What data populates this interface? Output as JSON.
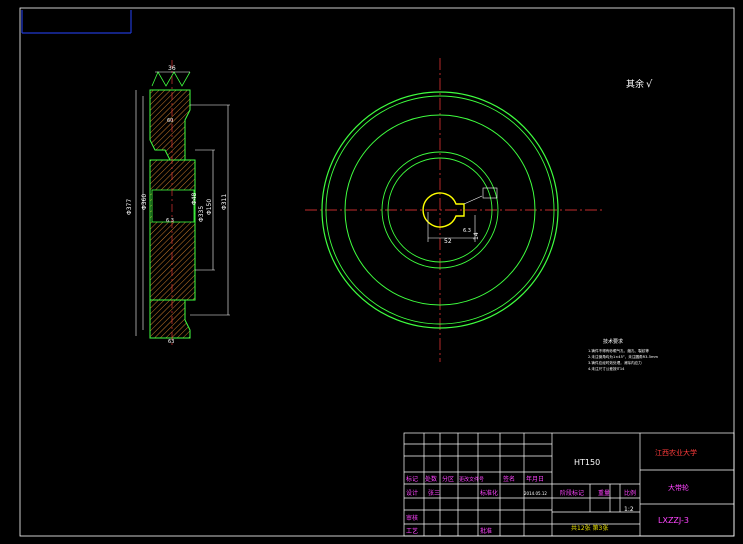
{
  "colors": {
    "background": "#000000",
    "outline": "#3fff3f",
    "hatch": "#c87a2a",
    "centerline": "#ff3b3b",
    "frame": "#2038d0",
    "dimension": "#ffffff",
    "title_red": "#ff3b3b",
    "title_magenta": "#ff44ff",
    "title_yellow": "#e8e000",
    "title_cyan": "#28d6ff"
  },
  "section_view": {
    "dim_top_width": "36",
    "dim_outer_dia": "Φ377",
    "dim_groove_dia": "Φ360",
    "dim_hub_dia": "Φ311",
    "dim_bore_dia": "Φ150",
    "dim_bore_small": "Φ48",
    "dim_hub_width": "60",
    "dim_bore_label": "Φ335",
    "dim_side_label": "6.3",
    "dim_bottom": "63"
  },
  "front_view": {
    "keyway_width": "14",
    "keyway_depth": "52",
    "roughness_tag": "6.3"
  },
  "surface_note": "其余",
  "surface_symbol": "√",
  "tech_requirements": {
    "title": "技术要求",
    "items": [
      "1.铸件不得有砂眼气孔、缩孔、裂纹等",
      "2.未注倒角均为1×45°，未注圆角R3-5mm",
      "3.铸件应经时效处理，消除内应力",
      "4.未注尺寸公差按IT14"
    ]
  },
  "title_block": {
    "material": "HT150",
    "university": "江西农业大学",
    "part_name": "大带轮",
    "drawing_no": "LXZZJ-3",
    "scale": "1:2",
    "sheet_info": "共12张 第3张",
    "stage_mark_label": "阶段标记",
    "weight_label": "重量",
    "scale_label": "比例",
    "row_labels": [
      "标记",
      "处数",
      "分区",
      "更改文件号",
      "签名",
      "年月日"
    ],
    "design_label": "设计",
    "standard_label": "标准化",
    "review_label": "审核",
    "process_label": "工艺",
    "approve_label": "批准",
    "designer": "张三",
    "standardizer": "标准化",
    "date": "2014.05.12"
  }
}
